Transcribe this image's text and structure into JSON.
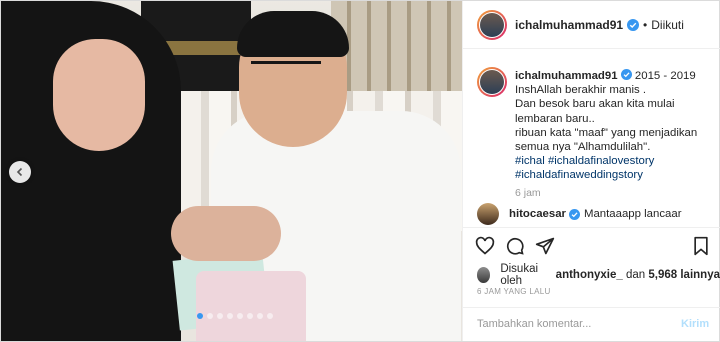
{
  "header": {
    "username": "ichalmuhammad91",
    "separator": "•",
    "follow_label": "Diikuti"
  },
  "caption": {
    "username": "ichalmuhammad91",
    "lines": [
      "2015 - 2019",
      "InshAllah berakhir manis .",
      "Dan besok baru akan kita mulai",
      "lembaran baru..",
      "ribuan kata \"maaf\" yang menjadikan",
      "semua nya \"Alhamdulilah\"."
    ],
    "hashtags": [
      "#ichal",
      "#ichaldafinalovestory",
      "#ichaldafinaweddingstory"
    ],
    "time": "6 jam"
  },
  "comment": {
    "username": "hitocaesar",
    "text": "Mantaaapp lancaar"
  },
  "likes": {
    "prefix": "Disukai oleh",
    "user": "anthonyxie_",
    "and": "dan",
    "count": "5,968",
    "suffix": "lainnya"
  },
  "timestamp": "6 JAM YANG LALU",
  "comment_box": {
    "placeholder": "Tambahkan komentar...",
    "post_label": "Kirim"
  },
  "media": {
    "dots_total": 8,
    "active_dot": 0
  },
  "colors": {
    "accent": "#3897f0",
    "hashtag": "#003569",
    "muted": "#999999",
    "post_disabled": "#b2dffc"
  }
}
